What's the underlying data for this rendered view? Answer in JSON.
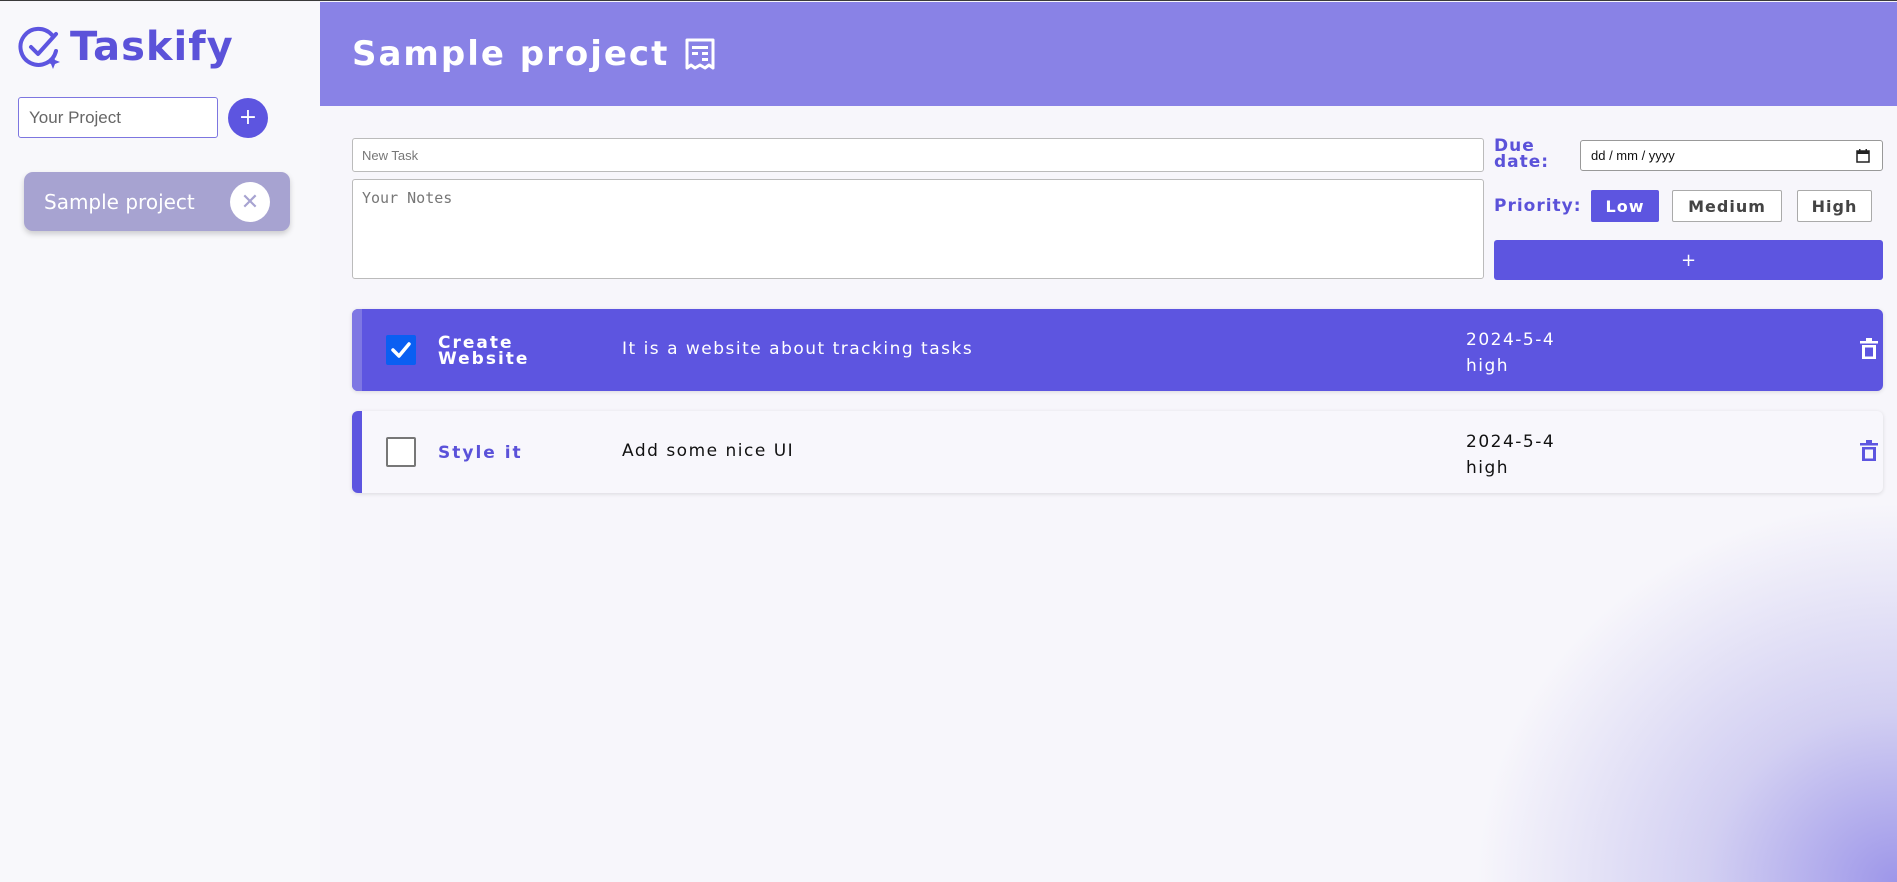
{
  "app": {
    "name": "Taskify",
    "brand_color": "#5d55e0"
  },
  "sidebar": {
    "project_input_placeholder": "Your Project",
    "add_project_label": "+",
    "projects": [
      {
        "label": "Sample project",
        "remove_label": "✕"
      }
    ]
  },
  "header": {
    "title": "Sample project",
    "icon": "receipt-icon"
  },
  "form": {
    "task_placeholder": "New Task",
    "notes_placeholder": "Your Notes",
    "due_label": "Due date:",
    "date_placeholder": "dd / mm / yyyy",
    "priority_label": "Priority:",
    "priority_options": [
      "Low",
      "Medium",
      "High"
    ],
    "priority_selected": "Low",
    "add_task_label": "+"
  },
  "tasks": [
    {
      "title": "Create Website",
      "notes": "It is a website about tracking tasks",
      "due": "2024-5-4",
      "priority": "high",
      "completed": true
    },
    {
      "title": "Style it",
      "notes": "Add some nice UI",
      "due": "2024-5-4",
      "priority": "high",
      "completed": false
    }
  ]
}
